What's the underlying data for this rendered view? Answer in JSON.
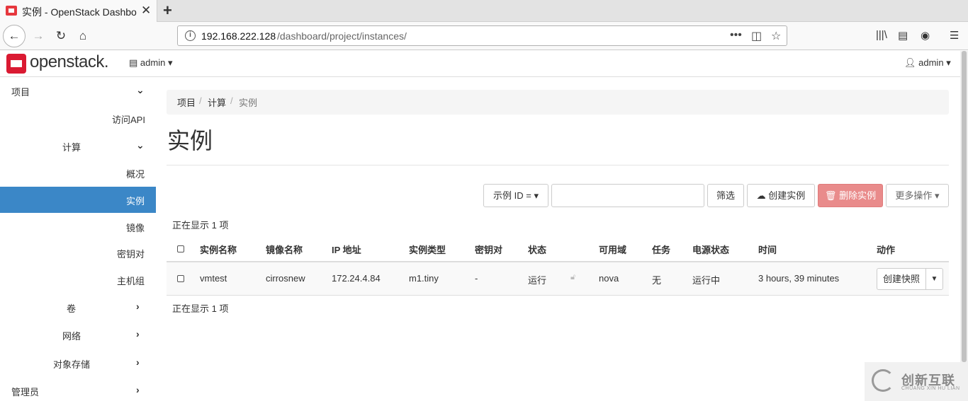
{
  "browser": {
    "tab_title": "实例 - OpenStack Dashbo",
    "tab_close": "✕",
    "new_tab": "+",
    "url_host": "192.168.222.128",
    "url_path": "/dashboard/project/instances/"
  },
  "header": {
    "logo_text": "openstack.",
    "project_menu": "admin",
    "user_menu": "admin"
  },
  "sidebar": {
    "items": [
      {
        "label": "项目"
      },
      {
        "label": "访问API"
      },
      {
        "label": "计算"
      },
      {
        "label": "概况"
      },
      {
        "label": "实例"
      },
      {
        "label": "镜像"
      },
      {
        "label": "密钥对"
      },
      {
        "label": "主机组"
      },
      {
        "label": "卷"
      },
      {
        "label": "网络"
      },
      {
        "label": "对象存储"
      },
      {
        "label": "管理员"
      }
    ]
  },
  "breadcrumb": [
    "项目",
    "计算",
    "实例"
  ],
  "page_title": "实例",
  "toolbar": {
    "filter_select": "示例 ID =",
    "filter_button": "筛选",
    "create_button": "创建实例",
    "delete_button": "删除实例",
    "more_button": "更多操作"
  },
  "count_text": "正在显示 1 项",
  "table": {
    "headers": [
      "实例名称",
      "镜像名称",
      "IP 地址",
      "实例类型",
      "密钥对",
      "状态",
      "可用域",
      "任务",
      "电源状态",
      "时间",
      "动作"
    ],
    "rows": [
      {
        "name": "vmtest",
        "image": "cirrosnew",
        "ip": "172.24.4.84",
        "flavor": "m1.tiny",
        "keypair": "-",
        "status": "运行",
        "zone": "nova",
        "task": "无",
        "power": "运行中",
        "time": "3 hours, 39 minutes",
        "action": "创建快照"
      }
    ]
  },
  "watermark": {
    "text": "创新互联",
    "sub": "CHUANG XIN HU LIAN"
  },
  "colors": {
    "accent": "#3b87c7",
    "danger": "#e98b8b",
    "link": "#2a7bbf",
    "logo": "#da1a32"
  }
}
